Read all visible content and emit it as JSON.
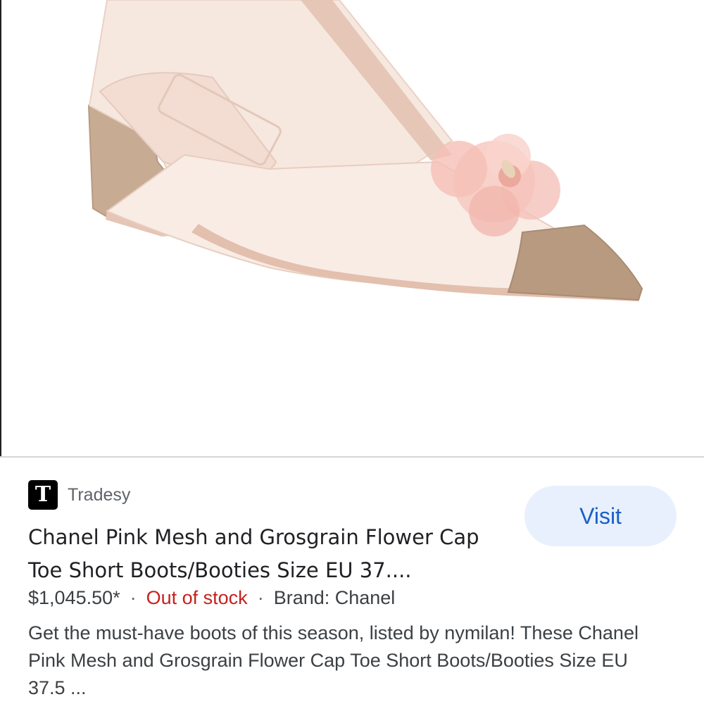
{
  "product_image": {
    "alt": "Chanel pink mesh bootie with camellia flower and beige cap toe",
    "colors": {
      "mesh": "#f6e6dc",
      "trim": "#e8c4b4",
      "heel": "#c7ab93",
      "cap_toe": "#b89a80",
      "flower": "#f5c0b8"
    }
  },
  "result": {
    "source": {
      "logo_letter": "T",
      "name": "Tradesy"
    },
    "visit_label": "Visit",
    "title": "Chanel Pink Mesh and Grosgrain Flower Cap Toe Short Boots/Booties Size EU 37....",
    "price": "$1,045.50*",
    "separator": "·",
    "stock_status": "Out of stock",
    "brand": "Brand: Chanel",
    "description": "Get the must-have boots of this season, listed by nymilan! These Chanel Pink Mesh and Grosgrain Flower Cap Toe Short Boots/Booties Size EU 37.5 ..."
  },
  "colors": {
    "visit_bg": "#e8f0fe",
    "visit_text": "#1a5fc7",
    "out_of_stock": "#c5221f"
  }
}
